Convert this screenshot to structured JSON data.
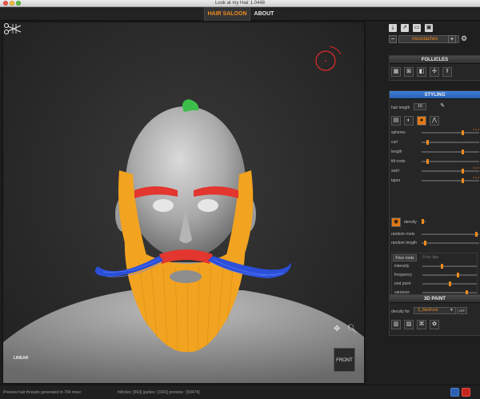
{
  "window": {
    "title": "Look at my Hair 1.0448"
  },
  "menu": {
    "tabs": [
      {
        "label": "HAIR SALOON",
        "active": true
      },
      {
        "label": "ABOUT",
        "active": false
      }
    ]
  },
  "viewport": {
    "front_label": "FRONT",
    "mode_label": "LINEAR"
  },
  "panel": {
    "group_select": "moustaches",
    "follicles": {
      "title": "FOLLICLES"
    },
    "styling": {
      "title": "STYLING",
      "hair_length_label": "hair length",
      "hair_length_value": "16",
      "sliders": [
        {
          "label": "spheres",
          "level": 0.72,
          "xy": "x y z"
        },
        {
          "label": "curl",
          "level": 0.08
        },
        {
          "label": "length",
          "level": 0.72
        },
        {
          "label": "tilt roots",
          "level": 0.08
        },
        {
          "label": "swirl",
          "level": 0.73,
          "xy": "x y z"
        },
        {
          "label": "taper",
          "level": 0.73,
          "xy": "x y z"
        }
      ],
      "density_label": "density",
      "density_level": 0.05,
      "random_roots_label": "random roots",
      "random_roots_level": 0.97,
      "random_length_label": "random length",
      "random_length_level": 0.05,
      "frizz_tabs": [
        "Frizz roots",
        "Frizz tips"
      ],
      "frizz_sliders": [
        {
          "label": "intensity",
          "level": 0.36
        },
        {
          "label": "frequency",
          "level": 0.66
        },
        {
          "label": "end point",
          "level": 0.5
        },
        {
          "label": "variance",
          "level": 0.83
        }
      ]
    },
    "paint": {
      "title": "3D PAINT",
      "density_for_label": "density for",
      "density_for_value": "3_SkinFoot",
      "toggle": "OFF"
    }
  },
  "status": {
    "message": "Preview hair threads generated in 794 msec",
    "follicles_label": "follicles: [963] guides: [1041] preview : [69474]"
  },
  "colors": {
    "accent": "#f08a1c",
    "active_section": "#3f7fd9",
    "beard": "#f2a320",
    "brows": "#e2362f",
    "moustache": "#2b4fd8",
    "tuft": "#3dbe4a"
  },
  "icons": [
    "save-icon",
    "export-icon",
    "folder-icon",
    "floppy-icon",
    "minus-icon",
    "plus-icon",
    "gear-icon",
    "move-icon",
    "zoom-icon",
    "scissors-icon",
    "power-icon"
  ]
}
